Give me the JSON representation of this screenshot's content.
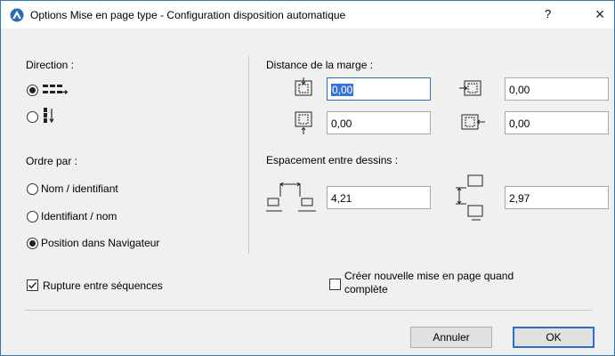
{
  "window": {
    "title": "Options Mise en page type  - Configuration disposition automatique",
    "help_label": "?",
    "close_label": "×"
  },
  "direction": {
    "heading": "Direction :",
    "options": [
      {
        "icon": "horizontal-direction-icon",
        "selected": true
      },
      {
        "icon": "vertical-direction-icon",
        "selected": false
      }
    ]
  },
  "order": {
    "heading": "Ordre par :",
    "options": [
      {
        "label": "Nom  / identifiant",
        "selected": false
      },
      {
        "label": "Identifiant / nom",
        "selected": false
      },
      {
        "label": "Position dans Navigateur",
        "selected": true
      }
    ]
  },
  "margin": {
    "heading": "Distance de la marge :",
    "top": "0,00",
    "left": "0,00",
    "bottom": "0,00",
    "right": "0,00"
  },
  "spacing": {
    "heading": "Espacement entre dessins :",
    "horizontal": "4,21",
    "vertical": "2,97"
  },
  "options": {
    "break_label": "Rupture entre séquences",
    "break_checked": true,
    "new_layout_label_line1": "Créer nouvelle mise en page quand",
    "new_layout_label_line2": "complète",
    "new_layout_checked": false
  },
  "buttons": {
    "cancel": "Annuler",
    "ok": "OK"
  },
  "colors": {
    "accent": "#2a6fc9",
    "selection": "#3875d7"
  }
}
